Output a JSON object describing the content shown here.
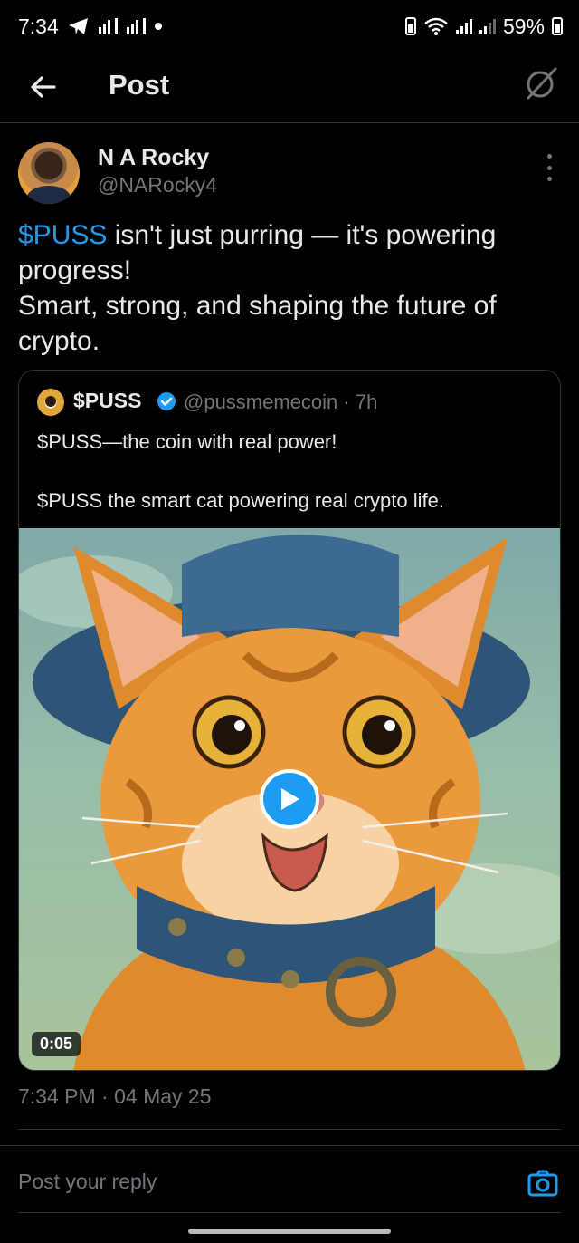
{
  "status_bar": {
    "time": "7:34",
    "battery": "59%",
    "icons": [
      "telegram-icon",
      "signal-icon",
      "signal-icon",
      "dot-icon",
      "battery-saver-icon",
      "wifi-icon",
      "signal-icon",
      "signal-icon",
      "battery-icon"
    ]
  },
  "header": {
    "title": "Post",
    "back_icon": "back-arrow-icon",
    "grok_icon": "grok-icon"
  },
  "post": {
    "author_name": "N A Rocky",
    "author_handle": "@NARocky4",
    "cashtag": "$PUSS",
    "text_rest": " isn't just purring — it's powering progress!",
    "text_line2": "Smart, strong, and shaping the future of crypto.",
    "timestamp": "7:34 PM · 04 May 25"
  },
  "quote": {
    "name": "$PUSS",
    "handle_time": "@pussmemecoin · 7h",
    "line1": "$PUSS—the coin with real power!",
    "line2": "$PUSS the smart cat powering real crypto life.",
    "video_duration": "0:05"
  },
  "reply": {
    "placeholder": "Post your reply"
  },
  "colors": {
    "background": "#000000",
    "text": "#e7e9ea",
    "muted": "#71767b",
    "accent": "#1d9bf0",
    "border": "#2f3336"
  }
}
